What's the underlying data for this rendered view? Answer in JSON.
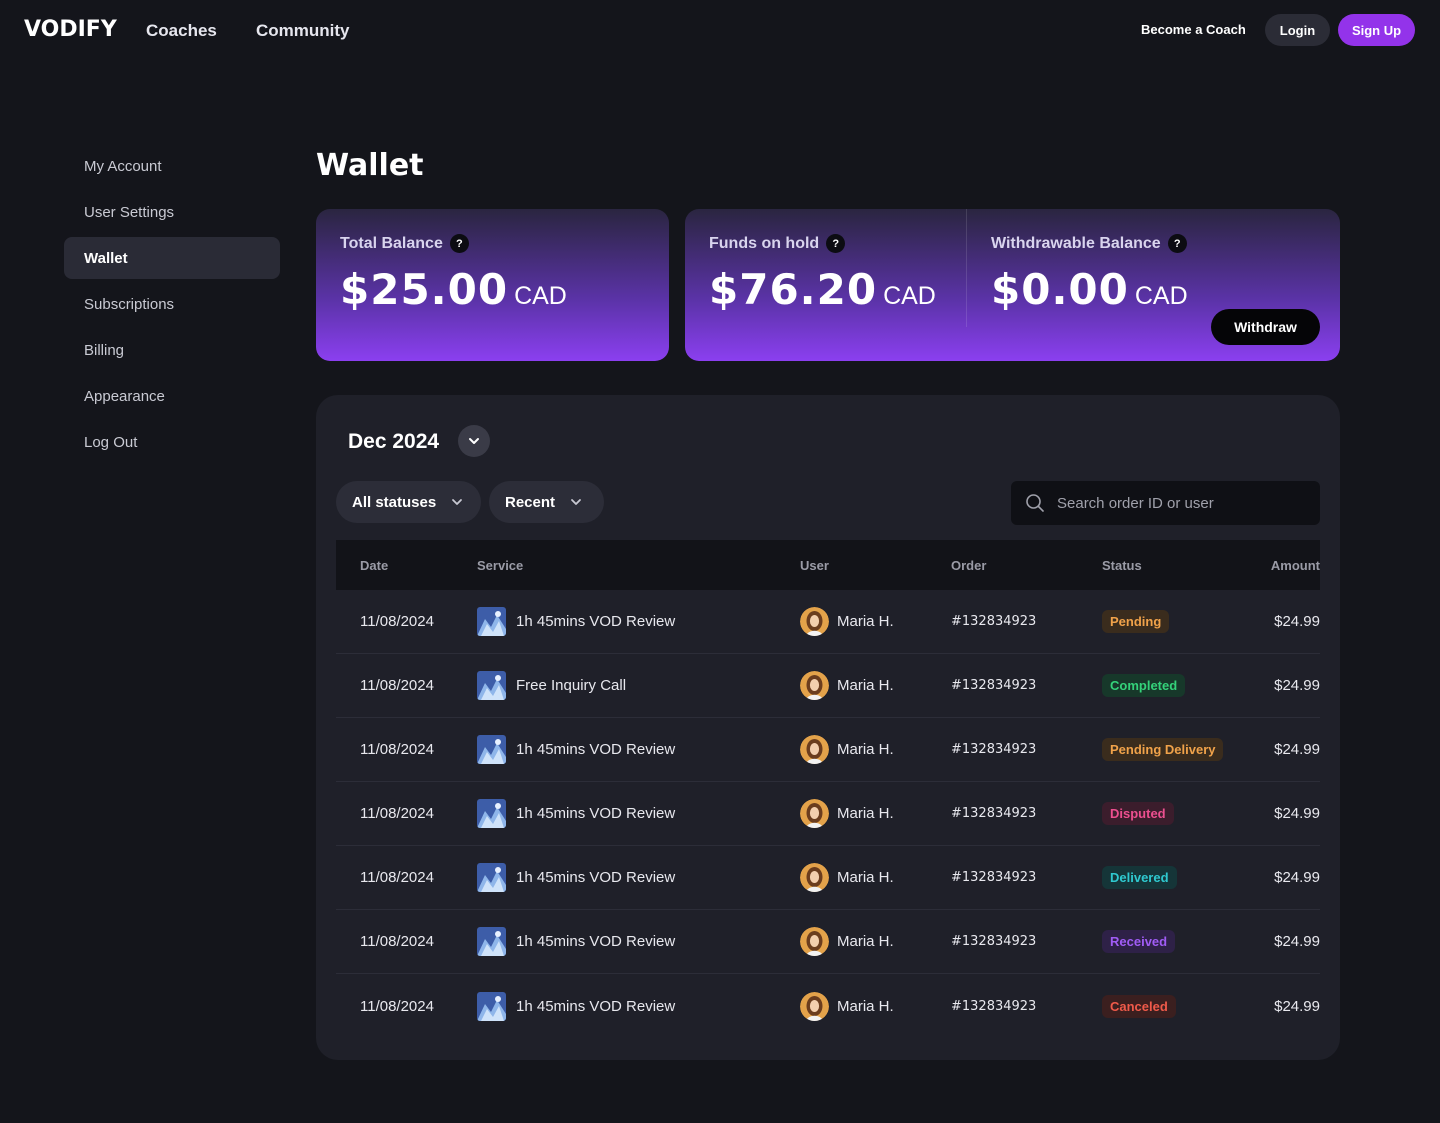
{
  "header": {
    "logo": "VODIFY",
    "nav": [
      "Coaches",
      "Community"
    ],
    "become_coach": "Become a Coach",
    "login": "Login",
    "signup": "Sign Up",
    "signup_color": "#9333ea"
  },
  "sidebar": {
    "items": [
      {
        "label": "My Account",
        "active": false
      },
      {
        "label": "User Settings",
        "active": false
      },
      {
        "label": "Wallet",
        "active": true
      },
      {
        "label": "Subscriptions",
        "active": false
      },
      {
        "label": "Billing",
        "active": false
      },
      {
        "label": "Appearance",
        "active": false
      },
      {
        "label": "Log Out",
        "active": false
      }
    ]
  },
  "page": {
    "title": "Wallet"
  },
  "balances": {
    "total": {
      "label": "Total Balance",
      "amount": "$25.00",
      "currency": "CAD"
    },
    "hold": {
      "label": "Funds on hold",
      "amount": "$76.20",
      "currency": "CAD"
    },
    "withdrawable": {
      "label": "Withdrawable Balance",
      "amount": "$0.00",
      "currency": "CAD"
    },
    "help_icon": "?",
    "withdraw_button": "Withdraw"
  },
  "transactions": {
    "month": "Dec 2024",
    "filters": {
      "status": "All statuses",
      "sort": "Recent"
    },
    "search_placeholder": "Search order ID or user",
    "columns": {
      "date": "Date",
      "service": "Service",
      "user": "User",
      "order": "Order",
      "status": "Status",
      "amount": "Amount"
    },
    "rows": [
      {
        "date": "11/08/2024",
        "service": "1h 45mins VOD Review",
        "user": "Maria H.",
        "order": "#132834923",
        "status": "Pending",
        "amount": "$24.99"
      },
      {
        "date": "11/08/2024",
        "service": "Free Inquiry Call",
        "user": "Maria H.",
        "order": "#132834923",
        "status": "Completed",
        "amount": "$24.99"
      },
      {
        "date": "11/08/2024",
        "service": "1h 45mins VOD Review",
        "user": "Maria H.",
        "order": "#132834923",
        "status": "Pending Delivery",
        "amount": "$24.99"
      },
      {
        "date": "11/08/2024",
        "service": "1h 45mins VOD Review",
        "user": "Maria H.",
        "order": "#132834923",
        "status": "Disputed",
        "amount": "$24.99"
      },
      {
        "date": "11/08/2024",
        "service": "1h 45mins VOD Review",
        "user": "Maria H.",
        "order": "#132834923",
        "status": "Delivered",
        "amount": "$24.99"
      },
      {
        "date": "11/08/2024",
        "service": "1h 45mins VOD Review",
        "user": "Maria H.",
        "order": "#132834923",
        "status": "Received",
        "amount": "$24.99"
      },
      {
        "date": "11/08/2024",
        "service": "1h 45mins VOD Review",
        "user": "Maria H.",
        "order": "#132834923",
        "status": "Canceled",
        "amount": "$24.99"
      }
    ],
    "status_colors": {
      "Pending": {
        "fg": "#f0a24a",
        "bg": "#3a2c1d"
      },
      "Completed": {
        "fg": "#34d27a",
        "bg": "#17382a"
      },
      "Pending Delivery": {
        "fg": "#f0a24a",
        "bg": "#3a2c1d"
      },
      "Disputed": {
        "fg": "#ec4f8f",
        "bg": "#3b1d2c"
      },
      "Delivered": {
        "fg": "#2fc9cf",
        "bg": "#153538"
      },
      "Received": {
        "fg": "#a05cf5",
        "bg": "#2e2147"
      },
      "Canceled": {
        "fg": "#ef5a4a",
        "bg": "#3b1f1f"
      }
    }
  }
}
